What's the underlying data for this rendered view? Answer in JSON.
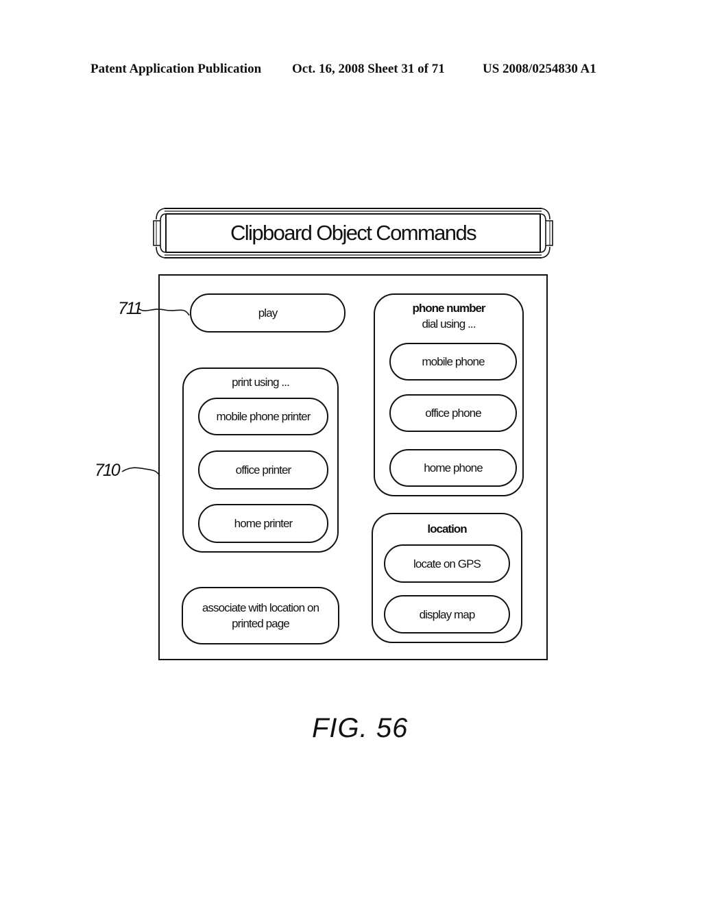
{
  "header": {
    "left": "Patent Application Publication",
    "middle": "Oct. 16, 2008  Sheet 31 of 71",
    "right": "US 2008/0254830 A1"
  },
  "title": "Clipboard Object Commands",
  "refs": {
    "dialog": "710",
    "play_button": "711"
  },
  "commands": {
    "play": "play",
    "print_group": {
      "title": "print using ...",
      "items": [
        "mobile phone printer",
        "office printer",
        "home printer"
      ]
    },
    "associate": "associate with location on printed page",
    "phone_group": {
      "title": "phone number",
      "subtitle": "dial using ...",
      "items": [
        "mobile phone",
        "office phone",
        "home phone"
      ]
    },
    "location_group": {
      "title": "location",
      "items": [
        "locate on GPS",
        "display map"
      ]
    }
  },
  "figure_label": "FIG. 56"
}
